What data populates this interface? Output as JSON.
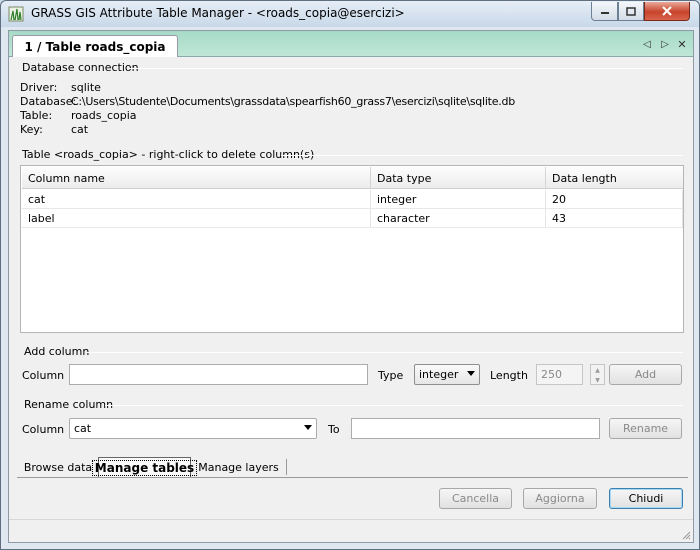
{
  "window": {
    "title": "GRASS GIS Attribute Table Manager - <roads_copia@esercizi>",
    "controls": {
      "minimize": "minimize-icon",
      "maximize": "maximize-icon",
      "close": "close-icon"
    }
  },
  "page_tab": {
    "label": "1 / Table roads_copia",
    "nav": {
      "left": "◁",
      "right": "▷",
      "close": "✕"
    }
  },
  "db_connection": {
    "title": "Database connection",
    "driver_label": "Driver:",
    "driver": "sqlite",
    "database_label": "Database:",
    "database": "C:\\Users\\Studente\\Documents\\grassdata\\spearfish60_grass7\\esercizi\\sqlite\\sqlite.db",
    "table_label": "Table:",
    "table": "roads_copia",
    "key_label": "Key:",
    "key": "cat"
  },
  "table_group": {
    "title": "Table <roads_copia> - right-click to delete column(s)",
    "columns": [
      "Column name",
      "Data type",
      "Data length"
    ],
    "rows": [
      [
        "cat",
        "integer",
        "20"
      ],
      [
        "label",
        "character",
        "43"
      ]
    ]
  },
  "add_column": {
    "title": "Add column",
    "column_label": "Column",
    "column_value": "",
    "type_label": "Type",
    "type_value": "integer",
    "length_label": "Length",
    "length_value": "250",
    "add_button": "Add"
  },
  "rename_column": {
    "title": "Rename column",
    "column_label": "Column",
    "column_value": "cat",
    "to_label": "To",
    "to_value": "",
    "rename_button": "Rename"
  },
  "bottom_tabs": [
    "Browse data",
    "Manage tables",
    "Manage layers"
  ],
  "buttons": {
    "cancel": "Cancella",
    "update": "Aggiorna",
    "close": "Chiudi"
  },
  "colors": {
    "tab_strip": "#bfe6d6",
    "window_frame": "#dfe8f1",
    "close_button": "#c8442c"
  }
}
